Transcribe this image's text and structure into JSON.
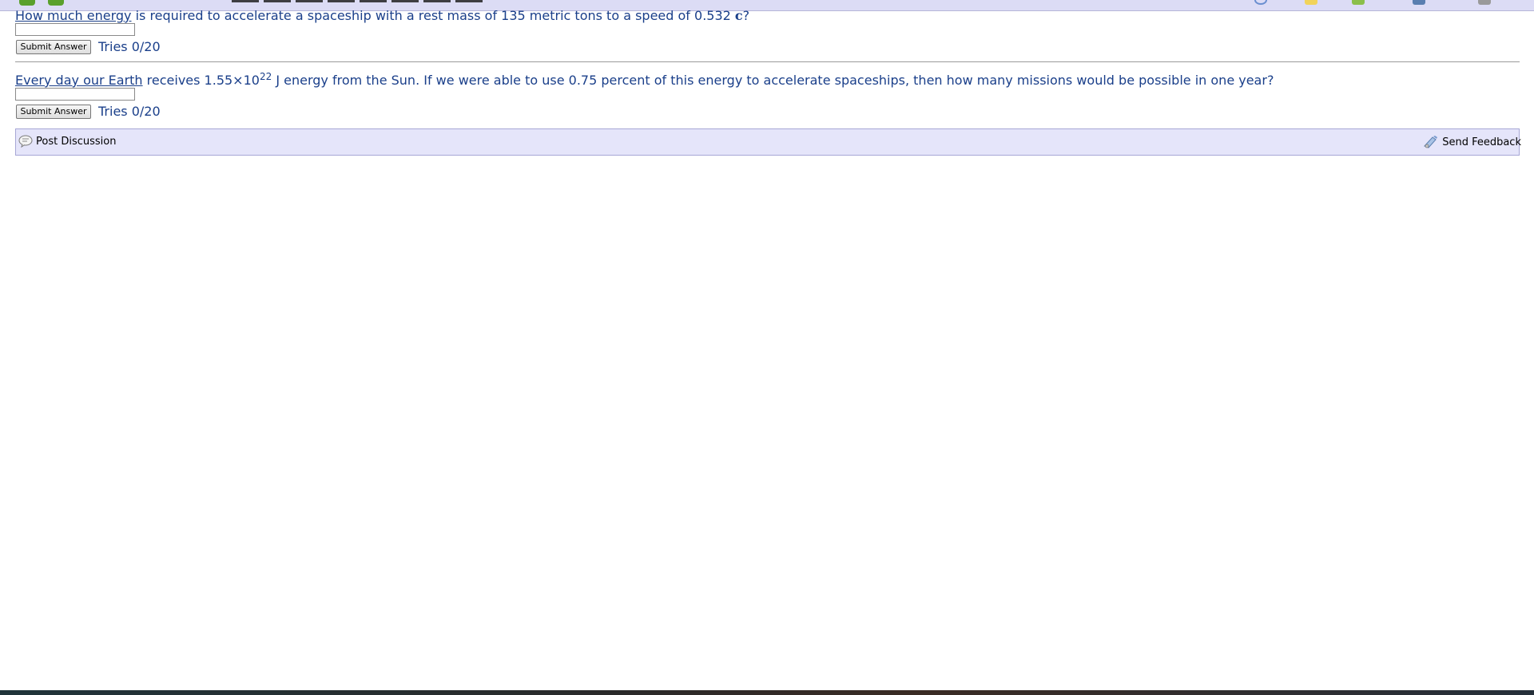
{
  "question1": {
    "link_text": "How much energy",
    "text_before_unit": " is required to accelerate a spaceship with a rest mass of 135 metric tons to a speed of 0.532 ",
    "unit": "c",
    "text_after_unit": "?",
    "input_value": "",
    "submit_label": "Submit Answer",
    "tries": "Tries 0/20"
  },
  "question2": {
    "link_text": "Every day our Earth",
    "text_before_exp": " receives 1.55×10",
    "exponent": "22",
    "text_after_exp": " J energy from the Sun. If we were able to use 0.75 percent of this energy to accelerate spaceships, then how many missions would be possible in one year?",
    "input_value": "",
    "submit_label": "Submit Answer",
    "tries": "Tries 0/20"
  },
  "bottom_bar": {
    "post_discussion": "Post Discussion",
    "send_feedback": "Send Feedback"
  },
  "colors": {
    "question_text": "#1a3f8a",
    "bar_background": "#e5e5fa",
    "bar_border": "#a7a7d6"
  },
  "icons": {
    "back": "back-arrow-icon",
    "forward": "forward-arrow-icon",
    "discussion": "discussion-bubble-icon",
    "feedback": "feedback-icon"
  }
}
